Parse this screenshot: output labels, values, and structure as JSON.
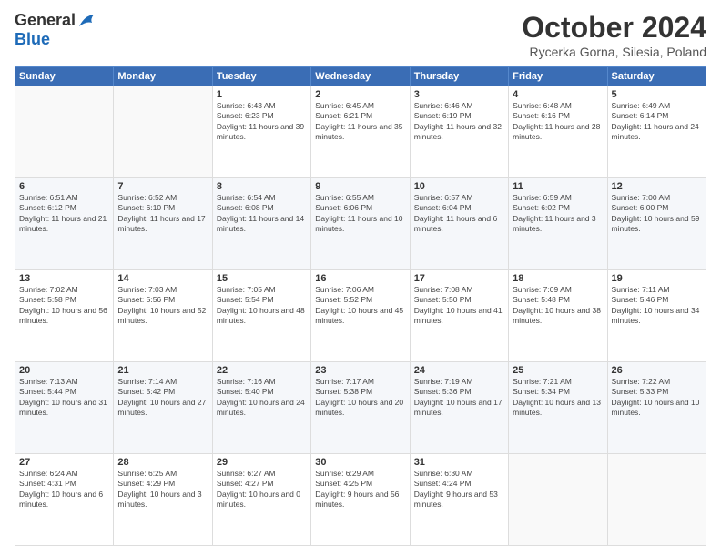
{
  "header": {
    "logo_general": "General",
    "logo_blue": "Blue",
    "month_title": "October 2024",
    "location": "Rycerka Gorna, Silesia, Poland"
  },
  "weekdays": [
    "Sunday",
    "Monday",
    "Tuesday",
    "Wednesday",
    "Thursday",
    "Friday",
    "Saturday"
  ],
  "weeks": [
    [
      {
        "day": "",
        "sunrise": "",
        "sunset": "",
        "daylight": ""
      },
      {
        "day": "",
        "sunrise": "",
        "sunset": "",
        "daylight": ""
      },
      {
        "day": "1",
        "sunrise": "Sunrise: 6:43 AM",
        "sunset": "Sunset: 6:23 PM",
        "daylight": "Daylight: 11 hours and 39 minutes."
      },
      {
        "day": "2",
        "sunrise": "Sunrise: 6:45 AM",
        "sunset": "Sunset: 6:21 PM",
        "daylight": "Daylight: 11 hours and 35 minutes."
      },
      {
        "day": "3",
        "sunrise": "Sunrise: 6:46 AM",
        "sunset": "Sunset: 6:19 PM",
        "daylight": "Daylight: 11 hours and 32 minutes."
      },
      {
        "day": "4",
        "sunrise": "Sunrise: 6:48 AM",
        "sunset": "Sunset: 6:16 PM",
        "daylight": "Daylight: 11 hours and 28 minutes."
      },
      {
        "day": "5",
        "sunrise": "Sunrise: 6:49 AM",
        "sunset": "Sunset: 6:14 PM",
        "daylight": "Daylight: 11 hours and 24 minutes."
      }
    ],
    [
      {
        "day": "6",
        "sunrise": "Sunrise: 6:51 AM",
        "sunset": "Sunset: 6:12 PM",
        "daylight": "Daylight: 11 hours and 21 minutes."
      },
      {
        "day": "7",
        "sunrise": "Sunrise: 6:52 AM",
        "sunset": "Sunset: 6:10 PM",
        "daylight": "Daylight: 11 hours and 17 minutes."
      },
      {
        "day": "8",
        "sunrise": "Sunrise: 6:54 AM",
        "sunset": "Sunset: 6:08 PM",
        "daylight": "Daylight: 11 hours and 14 minutes."
      },
      {
        "day": "9",
        "sunrise": "Sunrise: 6:55 AM",
        "sunset": "Sunset: 6:06 PM",
        "daylight": "Daylight: 11 hours and 10 minutes."
      },
      {
        "day": "10",
        "sunrise": "Sunrise: 6:57 AM",
        "sunset": "Sunset: 6:04 PM",
        "daylight": "Daylight: 11 hours and 6 minutes."
      },
      {
        "day": "11",
        "sunrise": "Sunrise: 6:59 AM",
        "sunset": "Sunset: 6:02 PM",
        "daylight": "Daylight: 11 hours and 3 minutes."
      },
      {
        "day": "12",
        "sunrise": "Sunrise: 7:00 AM",
        "sunset": "Sunset: 6:00 PM",
        "daylight": "Daylight: 10 hours and 59 minutes."
      }
    ],
    [
      {
        "day": "13",
        "sunrise": "Sunrise: 7:02 AM",
        "sunset": "Sunset: 5:58 PM",
        "daylight": "Daylight: 10 hours and 56 minutes."
      },
      {
        "day": "14",
        "sunrise": "Sunrise: 7:03 AM",
        "sunset": "Sunset: 5:56 PM",
        "daylight": "Daylight: 10 hours and 52 minutes."
      },
      {
        "day": "15",
        "sunrise": "Sunrise: 7:05 AM",
        "sunset": "Sunset: 5:54 PM",
        "daylight": "Daylight: 10 hours and 48 minutes."
      },
      {
        "day": "16",
        "sunrise": "Sunrise: 7:06 AM",
        "sunset": "Sunset: 5:52 PM",
        "daylight": "Daylight: 10 hours and 45 minutes."
      },
      {
        "day": "17",
        "sunrise": "Sunrise: 7:08 AM",
        "sunset": "Sunset: 5:50 PM",
        "daylight": "Daylight: 10 hours and 41 minutes."
      },
      {
        "day": "18",
        "sunrise": "Sunrise: 7:09 AM",
        "sunset": "Sunset: 5:48 PM",
        "daylight": "Daylight: 10 hours and 38 minutes."
      },
      {
        "day": "19",
        "sunrise": "Sunrise: 7:11 AM",
        "sunset": "Sunset: 5:46 PM",
        "daylight": "Daylight: 10 hours and 34 minutes."
      }
    ],
    [
      {
        "day": "20",
        "sunrise": "Sunrise: 7:13 AM",
        "sunset": "Sunset: 5:44 PM",
        "daylight": "Daylight: 10 hours and 31 minutes."
      },
      {
        "day": "21",
        "sunrise": "Sunrise: 7:14 AM",
        "sunset": "Sunset: 5:42 PM",
        "daylight": "Daylight: 10 hours and 27 minutes."
      },
      {
        "day": "22",
        "sunrise": "Sunrise: 7:16 AM",
        "sunset": "Sunset: 5:40 PM",
        "daylight": "Daylight: 10 hours and 24 minutes."
      },
      {
        "day": "23",
        "sunrise": "Sunrise: 7:17 AM",
        "sunset": "Sunset: 5:38 PM",
        "daylight": "Daylight: 10 hours and 20 minutes."
      },
      {
        "day": "24",
        "sunrise": "Sunrise: 7:19 AM",
        "sunset": "Sunset: 5:36 PM",
        "daylight": "Daylight: 10 hours and 17 minutes."
      },
      {
        "day": "25",
        "sunrise": "Sunrise: 7:21 AM",
        "sunset": "Sunset: 5:34 PM",
        "daylight": "Daylight: 10 hours and 13 minutes."
      },
      {
        "day": "26",
        "sunrise": "Sunrise: 7:22 AM",
        "sunset": "Sunset: 5:33 PM",
        "daylight": "Daylight: 10 hours and 10 minutes."
      }
    ],
    [
      {
        "day": "27",
        "sunrise": "Sunrise: 6:24 AM",
        "sunset": "Sunset: 4:31 PM",
        "daylight": "Daylight: 10 hours and 6 minutes."
      },
      {
        "day": "28",
        "sunrise": "Sunrise: 6:25 AM",
        "sunset": "Sunset: 4:29 PM",
        "daylight": "Daylight: 10 hours and 3 minutes."
      },
      {
        "day": "29",
        "sunrise": "Sunrise: 6:27 AM",
        "sunset": "Sunset: 4:27 PM",
        "daylight": "Daylight: 10 hours and 0 minutes."
      },
      {
        "day": "30",
        "sunrise": "Sunrise: 6:29 AM",
        "sunset": "Sunset: 4:25 PM",
        "daylight": "Daylight: 9 hours and 56 minutes."
      },
      {
        "day": "31",
        "sunrise": "Sunrise: 6:30 AM",
        "sunset": "Sunset: 4:24 PM",
        "daylight": "Daylight: 9 hours and 53 minutes."
      },
      {
        "day": "",
        "sunrise": "",
        "sunset": "",
        "daylight": ""
      },
      {
        "day": "",
        "sunrise": "",
        "sunset": "",
        "daylight": ""
      }
    ]
  ]
}
